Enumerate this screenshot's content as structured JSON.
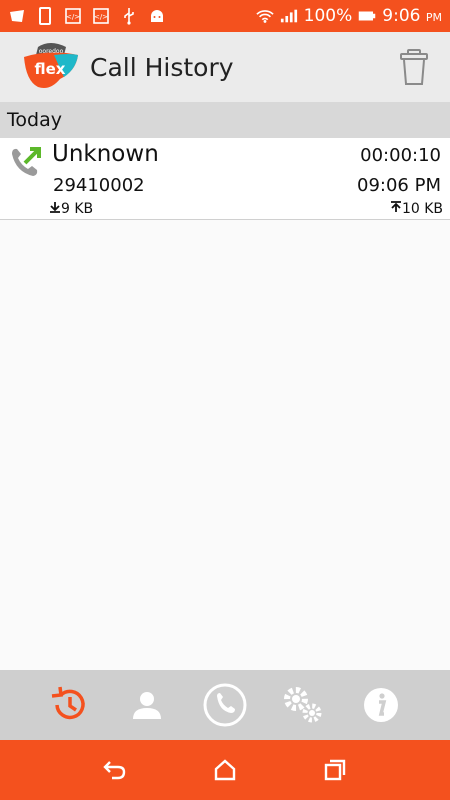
{
  "status_bar": {
    "battery": "100%",
    "time": "9:06",
    "ampm": "PM"
  },
  "app": {
    "title": "Call History",
    "logo_text": "flex",
    "logo_top_text": "ooredoo"
  },
  "section": {
    "label": "Today"
  },
  "calls": [
    {
      "name": "Unknown",
      "number": "29410002",
      "duration": "00:00:10",
      "time": "09:06 PM",
      "download": "9 KB",
      "upload": "10 KB"
    }
  ],
  "tabs": [
    "history-icon",
    "contacts-icon",
    "dialer-icon",
    "settings-icon",
    "info-icon"
  ],
  "colors": {
    "accent": "#f4511e",
    "app_bar": "#ebebeb",
    "section": "#d8d8d8",
    "active_tab": "#f4511e"
  }
}
